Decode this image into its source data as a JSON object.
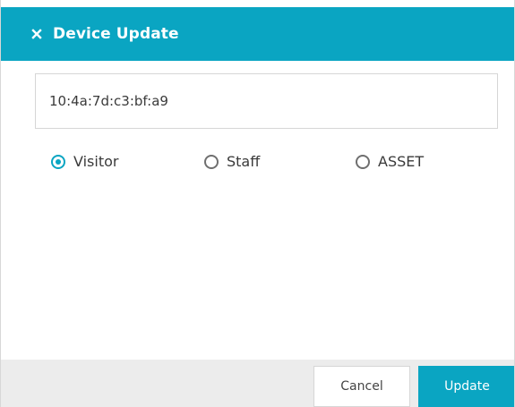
{
  "dialog": {
    "title": "Device Update",
    "close_icon": "close-icon",
    "accent_color": "#0aa5c2"
  },
  "mac_field": {
    "value": "10:4a:7d:c3:bf:a9"
  },
  "device_type": {
    "options": [
      {
        "label": "Visitor",
        "checked": true
      },
      {
        "label": "Staff",
        "checked": false
      },
      {
        "label": "ASSET",
        "checked": false
      }
    ]
  },
  "buttons": {
    "cancel_label": "Cancel",
    "update_label": "Update"
  }
}
